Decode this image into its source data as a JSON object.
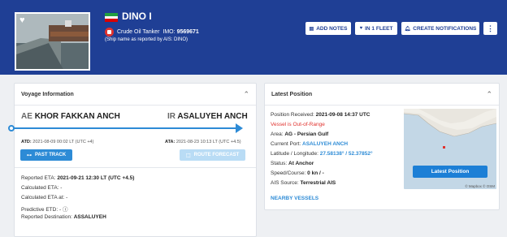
{
  "vessel": {
    "name": "DINO I",
    "type": "Crude Oil Tanker",
    "imo_label": "IMO:",
    "imo": "9569671",
    "reported_name": "(Ship name as reported by AIS: DINO)"
  },
  "actions": {
    "add_notes": "ADD NOTES",
    "in_fleet": "IN 1 FLEET",
    "create_notifications": "CREATE NOTIFICATIONS",
    "more": "⋮"
  },
  "voyage": {
    "title": "Voyage Information",
    "from_code": "AE",
    "from_port": "KHOR FAKKAN ANCH",
    "to_code": "IR",
    "to_port": "ASALUYEH ANCH",
    "atd_label": "ATD:",
    "atd_value": "2021-08-09 00:02 LT (UTC +4)",
    "ata_label": "ATA:",
    "ata_value": "2021-08-23 10:13 LT (UTC +4.5)",
    "past_track": "PAST TRACK",
    "route_forecast": "ROUTE FORECAST",
    "details": [
      {
        "label": "Reported ETA: ",
        "value": "2021-09-21 12:30 LT (UTC +4.5)"
      },
      {
        "label": "Calculated ETA: ",
        "value": "-"
      },
      {
        "label": "Calculated ETA at: ",
        "value": "-"
      },
      {
        "label": "Predictive ETD: ",
        "value": "- ⓘ"
      },
      {
        "label": "Reported Destination: ",
        "value": "ASSALUYEH"
      }
    ]
  },
  "position": {
    "title": "Latest Position",
    "received_label": "Position Received: ",
    "received_value": "2021-09-08 14:37 UTC",
    "warning": "Vessel is Out-of-Range",
    "area_label": "Area: ",
    "area_value": "AG - Persian Gulf",
    "port_label": "Current Port: ",
    "port_value": "ASALUYEH ANCH",
    "latlon_label": "Latitude / Longitude: ",
    "latlon_value": "27.58138° / 52.37852°",
    "status_label": "Status: ",
    "status_value": "At Anchor",
    "speed_label": "Speed/Course: ",
    "speed_value": "0 kn / -",
    "source_label": "AIS Source: ",
    "source_value": "Terrestrial AIS",
    "nearby": "NEARBY VESSELS",
    "map_button": "Latest Position",
    "attribution": "© Mapbox © OSM"
  },
  "colors": {
    "header": "#1f3f95",
    "accent": "#2d8bd6",
    "warning": "#e0322e",
    "iran_flag": [
      "#239f40",
      "#ffffff",
      "#da0000"
    ]
  }
}
